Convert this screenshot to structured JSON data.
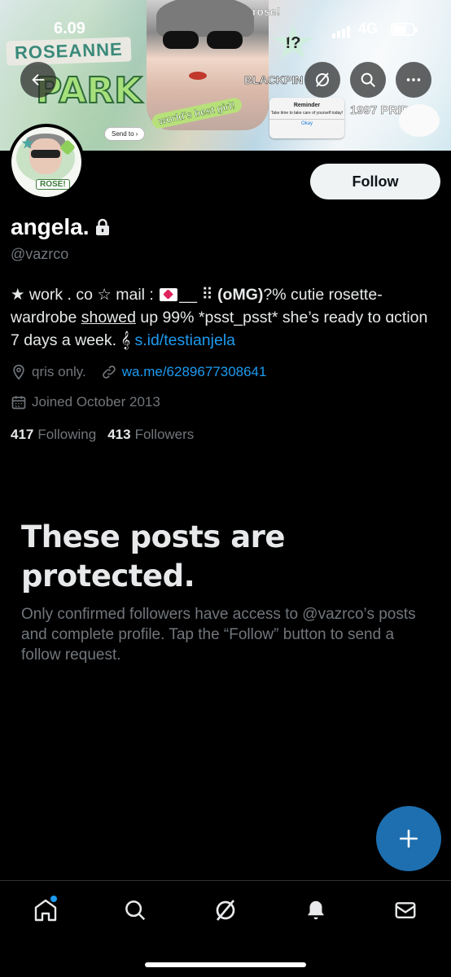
{
  "status_bar": {
    "time": "6.09",
    "network": "4G"
  },
  "banner": {
    "title_line1": "ROSEANNE",
    "title_line2": "PARK",
    "sticker_worlds": "world's best girl!",
    "send_to": "Send to ›",
    "rose_tag": "rose!",
    "star_text": "!?",
    "blackpink": "BLACKPIN",
    "reminder": {
      "title": "Reminder",
      "body": "Take time to take care of yourself today!",
      "ok": "Okay"
    },
    "pride": "1997 PRIDE"
  },
  "avatar": {
    "label": "ROSE!"
  },
  "actions": {
    "follow_label": "Follow"
  },
  "profile": {
    "display_name": "angela.",
    "handle": "@vazrco",
    "bio": {
      "part1": "★ work . co ☆ mail : ",
      "part2": "__ ⠿ ",
      "part3": "(ᴏMG)",
      "part4": "?% cutie rosette- wardrobe ",
      "underlined": "showed",
      "part5": " up 99% *psst_psst* she’s ready to ɑction 7 days a week. 𝄞 ",
      "link": "s.id/testianjela"
    },
    "location": "qris only.",
    "website": "wa.me/6289677308641",
    "joined": "Joined October 2013",
    "following_count": "417",
    "following_label": "Following",
    "followers_count": "413",
    "followers_label": "Followers"
  },
  "protected": {
    "title": "These posts are protected.",
    "body": "Only confirmed followers have access to @vazrco’s posts and complete profile. Tap the “Follow” button to send a follow request."
  },
  "colors": {
    "accent": "#1d9bf0",
    "fab": "#1d6fb0",
    "muted": "#71767b",
    "text": "#e7e9ea",
    "background": "#000000"
  },
  "icons": {
    "back": "arrow-left-icon",
    "explore": "explore-slash-icon",
    "search": "search-icon",
    "more": "more-dots-icon",
    "lock": "lock-icon",
    "location": "location-pin-icon",
    "link": "link-icon",
    "calendar": "calendar-icon",
    "fab": "plus-icon",
    "home": "home-icon",
    "tab_search": "search-icon",
    "tab_explore": "explore-slash-icon",
    "notifications": "bell-icon",
    "messages": "envelope-icon"
  }
}
